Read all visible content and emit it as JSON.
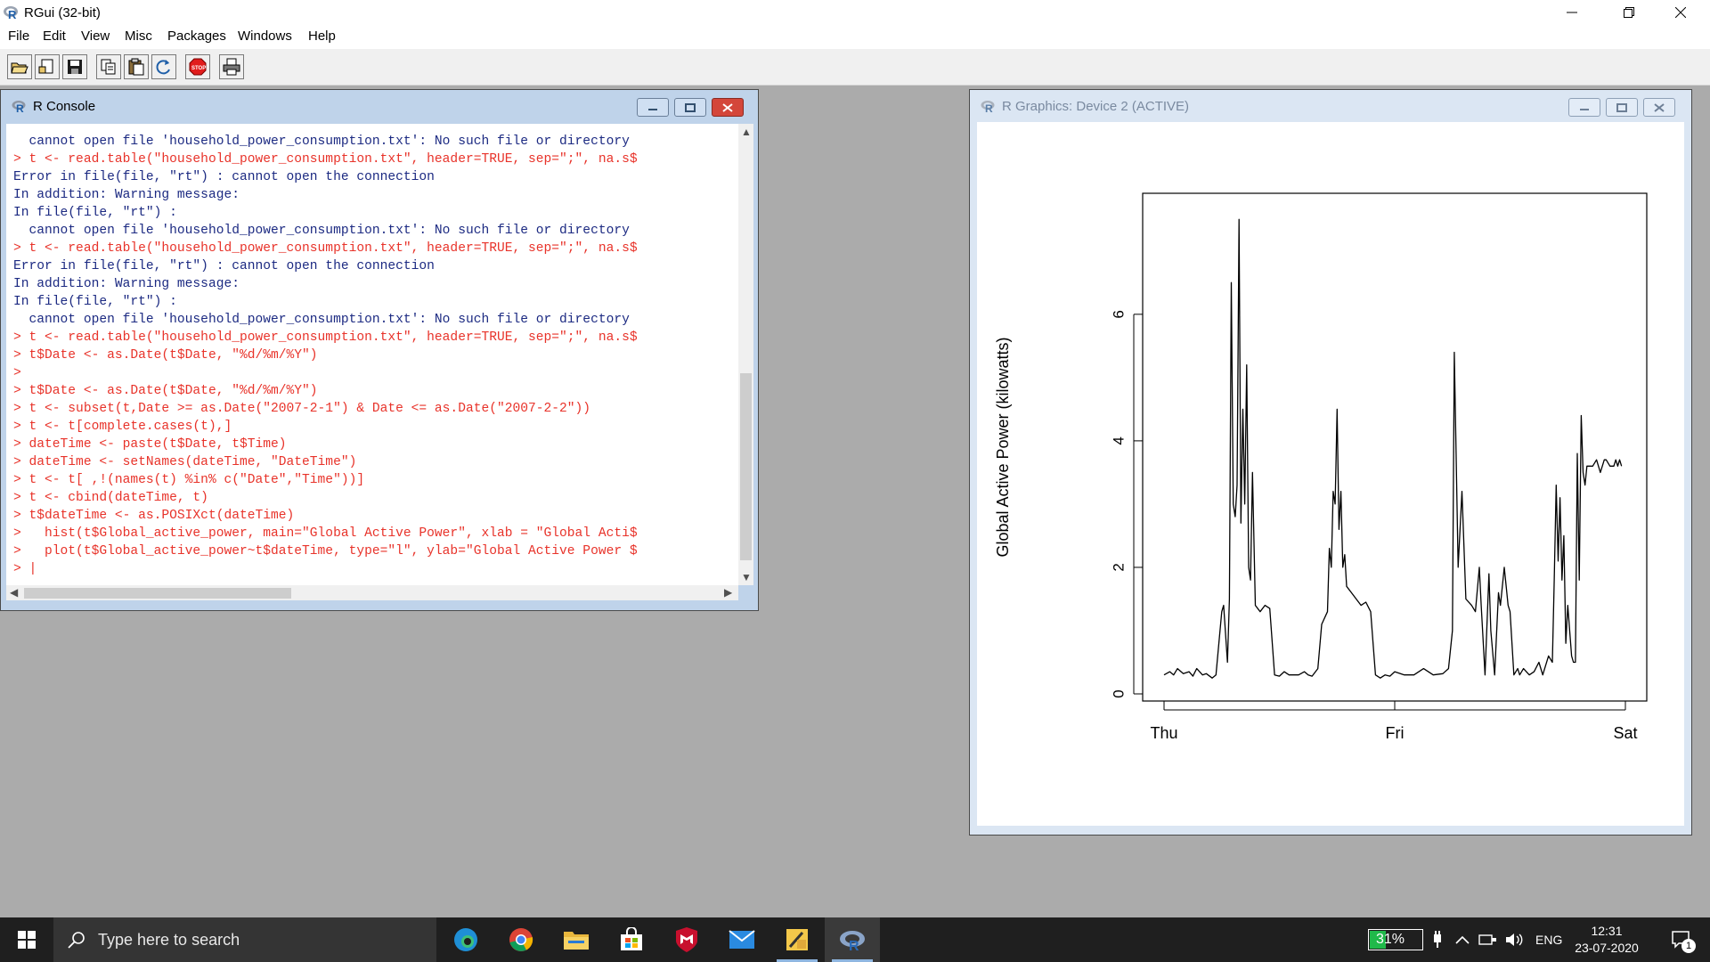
{
  "app": {
    "title": "RGui (32-bit)"
  },
  "menu": [
    "File",
    "Edit",
    "View",
    "Misc",
    "Packages",
    "Windows",
    "Help"
  ],
  "toolbar": {
    "buttons": [
      "open-script-icon",
      "load-workspace-icon",
      "save-icon",
      "copy-icon",
      "paste-icon",
      "copy-paste-icon",
      "stop-icon",
      "print-icon"
    ]
  },
  "console": {
    "title": "R Console",
    "lines": [
      {
        "kind": "out",
        "text": "  cannot open file 'household_power_consumption.txt': No such file or directory"
      },
      {
        "kind": "in",
        "text": "> t <- read.table(\"household_power_consumption.txt\", header=TRUE, sep=\";\", na.s$"
      },
      {
        "kind": "out",
        "text": "Error in file(file, \"rt\") : cannot open the connection"
      },
      {
        "kind": "out",
        "text": "In addition: Warning message:"
      },
      {
        "kind": "out",
        "text": "In file(file, \"rt\") :"
      },
      {
        "kind": "out",
        "text": "  cannot open file 'household_power_consumption.txt': No such file or directory"
      },
      {
        "kind": "in",
        "text": "> t <- read.table(\"household_power_consumption.txt\", header=TRUE, sep=\";\", na.s$"
      },
      {
        "kind": "out",
        "text": "Error in file(file, \"rt\") : cannot open the connection"
      },
      {
        "kind": "out",
        "text": "In addition: Warning message:"
      },
      {
        "kind": "out",
        "text": "In file(file, \"rt\") :"
      },
      {
        "kind": "out",
        "text": "  cannot open file 'household_power_consumption.txt': No such file or directory"
      },
      {
        "kind": "in",
        "text": "> t <- read.table(\"household_power_consumption.txt\", header=TRUE, sep=\";\", na.s$"
      },
      {
        "kind": "in",
        "text": "> t$Date <- as.Date(t$Date, \"%d/%m/%Y\")"
      },
      {
        "kind": "in",
        "text": ">"
      },
      {
        "kind": "in",
        "text": "> t$Date <- as.Date(t$Date, \"%d/%m/%Y\")"
      },
      {
        "kind": "in",
        "text": "> t <- subset(t,Date >= as.Date(\"2007-2-1\") & Date <= as.Date(\"2007-2-2\"))"
      },
      {
        "kind": "in",
        "text": "> t <- t[complete.cases(t),]"
      },
      {
        "kind": "in",
        "text": "> dateTime <- paste(t$Date, t$Time)"
      },
      {
        "kind": "in",
        "text": "> dateTime <- setNames(dateTime, \"DateTime\")"
      },
      {
        "kind": "in",
        "text": "> t <- t[ ,!(names(t) %in% c(\"Date\",\"Time\"))]"
      },
      {
        "kind": "in",
        "text": "> t <- cbind(dateTime, t)"
      },
      {
        "kind": "in",
        "text": "> t$dateTime <- as.POSIXct(dateTime)"
      },
      {
        "kind": "in",
        "text": ">   hist(t$Global_active_power, main=\"Global Active Power\", xlab = \"Global Acti$"
      },
      {
        "kind": "in",
        "text": ">   plot(t$Global_active_power~t$dateTime, type=\"l\", ylab=\"Global Active Power $"
      },
      {
        "kind": "in",
        "text": "> |"
      }
    ]
  },
  "graphics": {
    "title": "R Graphics: Device 2 (ACTIVE)"
  },
  "chart_data": {
    "type": "line",
    "title": "",
    "xlabel": "",
    "ylabel": "Global Active Power (kilowatts)",
    "x_ticks": [
      "Thu",
      "Fri",
      "Sat"
    ],
    "y_ticks": [
      0,
      2,
      4,
      6
    ],
    "xlim_days": [
      0,
      2
    ],
    "ylim": [
      0,
      7.8
    ],
    "series": [
      {
        "x_hours": [
          0,
          0.6,
          1,
          1.4,
          2,
          2.6,
          3,
          3.4,
          4,
          4.4,
          5,
          5.4,
          6,
          6.2,
          6.6,
          6.8,
          7,
          7.2,
          7.4,
          7.6,
          7.8,
          8,
          8.2,
          8.4,
          8.6,
          8.8,
          9,
          9.2,
          9.5,
          10,
          10.5,
          11,
          11.5,
          12,
          12.5,
          13,
          14,
          14.6,
          15,
          15.4,
          16,
          16.4,
          17,
          17.2,
          17.4,
          17.6,
          17.8,
          18,
          18.2,
          18.4,
          18.6,
          18.8,
          19,
          19.5,
          20,
          20.5,
          21,
          21.5,
          22,
          22.5,
          23,
          23.5,
          24,
          25,
          26,
          27,
          28,
          29,
          29.6,
          30,
          30.2,
          30.6,
          31,
          31.4,
          32,
          32.4,
          32.8,
          33,
          33.4,
          33.8,
          34,
          34.4,
          34.8,
          35,
          35.4,
          35.8,
          36,
          36.4,
          36.8,
          37,
          37.4,
          38,
          38.5,
          39,
          39.4,
          40,
          40.4,
          40.6,
          40.8,
          41,
          41.2,
          41.4,
          41.6,
          41.8,
          42,
          42.4,
          42.6,
          42.8,
          43,
          43.2,
          43.4,
          43.6,
          43.8,
          44,
          44.2,
          44.6,
          45,
          45.4,
          45.8,
          46,
          46.4,
          46.8,
          47,
          47.2,
          47.4,
          47.6,
          48
        ],
        "values": [
          0.3,
          0.35,
          0.3,
          0.4,
          0.32,
          0.35,
          0.28,
          0.4,
          0.3,
          0.32,
          0.25,
          0.3,
          1.3,
          1.4,
          0.5,
          1.5,
          6.5,
          3.0,
          2.8,
          3.3,
          7.5,
          2.7,
          4.5,
          3.0,
          5.2,
          2.0,
          1.8,
          3.5,
          1.4,
          1.3,
          1.4,
          1.35,
          0.3,
          0.28,
          0.35,
          0.3,
          0.3,
          0.35,
          0.3,
          0.28,
          0.4,
          1.1,
          1.3,
          2.3,
          2.0,
          3.2,
          3.0,
          4.5,
          2.6,
          3.2,
          2.0,
          2.2,
          1.7,
          1.6,
          1.5,
          1.4,
          1.45,
          1.3,
          0.3,
          0.25,
          0.3,
          0.28,
          0.35,
          0.3,
          0.3,
          0.4,
          0.3,
          0.32,
          0.4,
          1.0,
          5.4,
          2.0,
          3.2,
          1.5,
          1.4,
          1.3,
          2.0,
          1.4,
          0.3,
          1.9,
          1.0,
          0.3,
          1.6,
          1.4,
          2.0,
          1.4,
          1.3,
          0.3,
          0.4,
          0.3,
          0.4,
          0.3,
          0.35,
          0.5,
          0.3,
          0.6,
          0.5,
          1.8,
          3.3,
          2.1,
          3.1,
          1.8,
          2.5,
          0.8,
          1.4,
          0.6,
          0.5,
          0.5,
          3.8,
          1.8,
          4.4,
          3.5,
          3.3,
          3.6,
          3.6,
          3.6,
          3.7,
          3.5,
          3.7,
          3.7,
          3.6,
          3.6,
          3.7,
          3.6,
          3.7,
          3.6
        ]
      }
    ]
  },
  "taskbar": {
    "search_placeholder": "Type here to search",
    "apps": [
      "edge-icon",
      "chrome-icon",
      "file-explorer-icon",
      "store-icon",
      "mcafee-icon",
      "mail-icon",
      "sticky-app-icon",
      "r-app-icon"
    ],
    "battery": "31%",
    "language": "ENG",
    "time": "12:31",
    "date": "23-07-2020",
    "notification_count": "1"
  }
}
